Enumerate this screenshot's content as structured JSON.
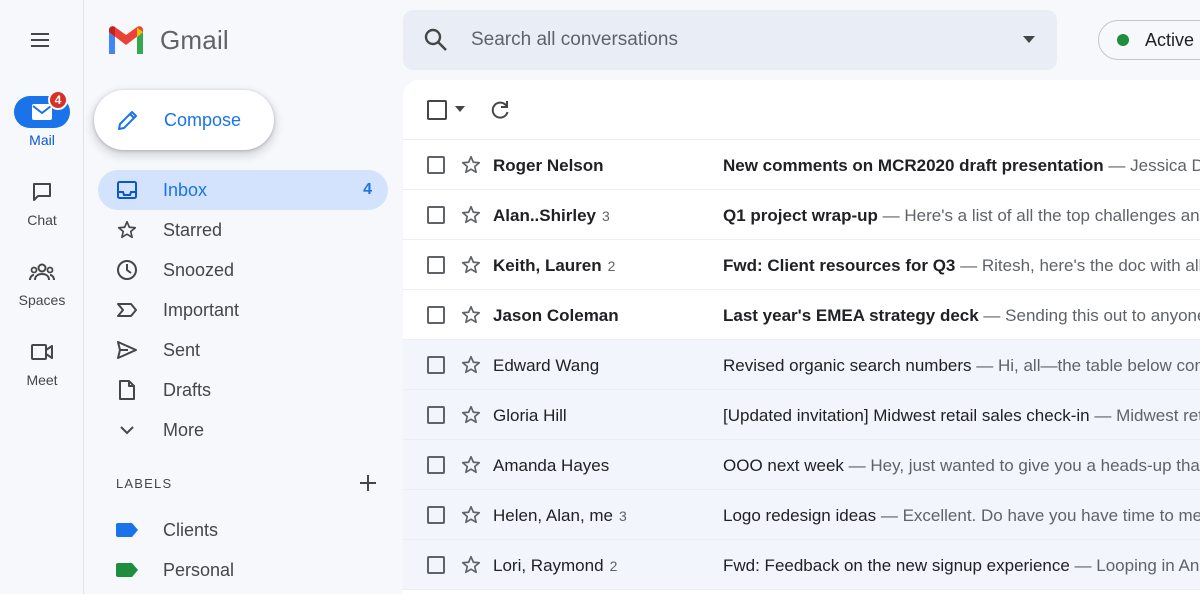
{
  "app": {
    "title": "Gmail",
    "colors": {
      "accent": "#1a73e8",
      "unread_badge": "#d93025",
      "active_status": "#1e8e3e",
      "label_clients": "#1a73e8",
      "label_personal": "#1e8e3e"
    }
  },
  "rail": {
    "menu_icon": "hamburger-menu-icon",
    "items": [
      {
        "label": "Mail",
        "icon": "mail-icon",
        "badge": "4",
        "active": true
      },
      {
        "label": "Chat",
        "icon": "chat-icon"
      },
      {
        "label": "Spaces",
        "icon": "spaces-icon"
      },
      {
        "label": "Meet",
        "icon": "meet-icon"
      }
    ]
  },
  "sidebar": {
    "compose_label": "Compose",
    "items": [
      {
        "label": "Inbox",
        "icon": "inbox-icon",
        "count": "4",
        "active": true
      },
      {
        "label": "Starred",
        "icon": "star-icon"
      },
      {
        "label": "Snoozed",
        "icon": "clock-icon"
      },
      {
        "label": "Important",
        "icon": "important-icon"
      },
      {
        "label": "Sent",
        "icon": "send-icon"
      },
      {
        "label": "Drafts",
        "icon": "draft-icon"
      },
      {
        "label": "More",
        "icon": "chevron-down-icon"
      }
    ],
    "labels_title": "LABELS",
    "labels": [
      {
        "label": "Clients",
        "color": "#1a73e8"
      },
      {
        "label": "Personal",
        "color": "#1e8e3e"
      }
    ]
  },
  "search": {
    "placeholder": "Search all conversations"
  },
  "status": {
    "label": "Active"
  },
  "mail_list": [
    {
      "sender": "Roger Nelson",
      "count": "",
      "subject": "New comments on MCR2020 draft presentation",
      "snippet": " — Jessica Dow said What about Eva? Make sure to sync with",
      "unread": true
    },
    {
      "sender": "Alan..Shirley",
      "count": "3",
      "subject": "Q1 project wrap-up ",
      "snippet": " — Here's a list of all the top challenges and findings",
      "unread": true
    },
    {
      "sender": "Keith, Lauren",
      "count": "2",
      "subject": "Fwd: Client resources for Q3",
      "snippet": " — Ritesh, here's the doc with all the client resources",
      "unread": true
    },
    {
      "sender": "Jason Coleman",
      "count": "",
      "subject": "Last year's EMEA strategy deck",
      "snippet": " — Sending this out to anyone who missed it",
      "unread": true
    },
    {
      "sender": "Edward Wang",
      "count": "",
      "subject": "Revised organic search numbers",
      "snippet": " — Hi, all—the table below contains the revised numbers",
      "unread": false
    },
    {
      "sender": "Gloria Hill",
      "count": "",
      "subject": "[Updated invitation] Midwest retail sales check-in",
      "snippet": " — Midwest retail sales check-in",
      "unread": false
    },
    {
      "sender": "Amanda Hayes",
      "count": "",
      "subject": "OOO next week",
      "snippet": " — Hey, just wanted to give you a heads-up that I'll be",
      "unread": false
    },
    {
      "sender": "Helen, Alan, me",
      "count": "3",
      "subject": "Logo redesign ideas",
      "snippet": " — Excellent. Do have you have time to meet",
      "unread": false
    },
    {
      "sender": "Lori, Raymond",
      "count": "2",
      "subject": "Fwd: Feedback on the new signup experience",
      "snippet": " — Looping in Annika. The feedback",
      "unread": false
    }
  ]
}
